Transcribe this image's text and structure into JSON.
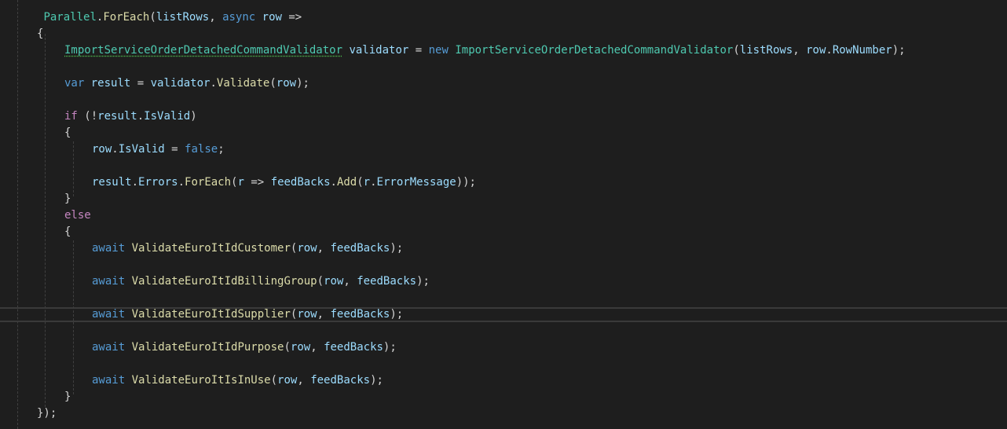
{
  "editor": {
    "theme_colors": {
      "background": "#1e1e1e",
      "plain": "#d4d4d4",
      "type": "#4ec9b0",
      "method": "#dcdcaa",
      "variable": "#9cdcfe",
      "keyword": "#569cd6",
      "control": "#c586c0"
    },
    "current_line_number": 17,
    "lines": [
      {
        "indent": 0,
        "tokens": [
          {
            "t": " ",
            "c": "plain"
          },
          {
            "t": "Parallel",
            "c": "type"
          },
          {
            "t": ".",
            "c": "plain"
          },
          {
            "t": "ForEach",
            "c": "method"
          },
          {
            "t": "(",
            "c": "plain"
          },
          {
            "t": "listRows",
            "c": "var"
          },
          {
            "t": ", ",
            "c": "plain"
          },
          {
            "t": "async",
            "c": "kw"
          },
          {
            "t": " ",
            "c": "plain"
          },
          {
            "t": "row",
            "c": "var"
          },
          {
            "t": " =>",
            "c": "plain"
          }
        ]
      },
      {
        "indent": 0,
        "tokens": [
          {
            "t": "{",
            "c": "plain"
          }
        ]
      },
      {
        "indent": 1,
        "tokens": [
          {
            "t": "ImportServiceOrderDetachedCommandValidator",
            "c": "type",
            "squiggle": true
          },
          {
            "t": " ",
            "c": "plain"
          },
          {
            "t": "validator",
            "c": "var"
          },
          {
            "t": " = ",
            "c": "plain"
          },
          {
            "t": "new",
            "c": "kw"
          },
          {
            "t": " ",
            "c": "plain"
          },
          {
            "t": "ImportServiceOrderDetachedCommandValidator",
            "c": "type"
          },
          {
            "t": "(",
            "c": "plain"
          },
          {
            "t": "listRows",
            "c": "var"
          },
          {
            "t": ", ",
            "c": "plain"
          },
          {
            "t": "row",
            "c": "var"
          },
          {
            "t": ".",
            "c": "plain"
          },
          {
            "t": "RowNumber",
            "c": "var"
          },
          {
            "t": ");",
            "c": "plain"
          }
        ]
      },
      {
        "indent": 1,
        "tokens": []
      },
      {
        "indent": 1,
        "tokens": [
          {
            "t": "var",
            "c": "kw"
          },
          {
            "t": " ",
            "c": "plain"
          },
          {
            "t": "result",
            "c": "var"
          },
          {
            "t": " = ",
            "c": "plain"
          },
          {
            "t": "validator",
            "c": "var"
          },
          {
            "t": ".",
            "c": "plain"
          },
          {
            "t": "Validate",
            "c": "method"
          },
          {
            "t": "(",
            "c": "plain"
          },
          {
            "t": "row",
            "c": "var"
          },
          {
            "t": ");",
            "c": "plain"
          }
        ]
      },
      {
        "indent": 1,
        "tokens": []
      },
      {
        "indent": 1,
        "tokens": [
          {
            "t": "if",
            "c": "ctrl"
          },
          {
            "t": " (!",
            "c": "plain"
          },
          {
            "t": "result",
            "c": "var"
          },
          {
            "t": ".",
            "c": "plain"
          },
          {
            "t": "IsValid",
            "c": "var"
          },
          {
            "t": ")",
            "c": "plain"
          }
        ]
      },
      {
        "indent": 1,
        "tokens": [
          {
            "t": "{",
            "c": "plain"
          }
        ]
      },
      {
        "indent": 2,
        "tokens": [
          {
            "t": "row",
            "c": "var"
          },
          {
            "t": ".",
            "c": "plain"
          },
          {
            "t": "IsValid",
            "c": "var"
          },
          {
            "t": " = ",
            "c": "plain"
          },
          {
            "t": "false",
            "c": "kw"
          },
          {
            "t": ";",
            "c": "plain"
          }
        ]
      },
      {
        "indent": 2,
        "tokens": []
      },
      {
        "indent": 2,
        "tokens": [
          {
            "t": "result",
            "c": "var"
          },
          {
            "t": ".",
            "c": "plain"
          },
          {
            "t": "Errors",
            "c": "var"
          },
          {
            "t": ".",
            "c": "plain"
          },
          {
            "t": "ForEach",
            "c": "method"
          },
          {
            "t": "(",
            "c": "plain"
          },
          {
            "t": "r",
            "c": "var"
          },
          {
            "t": " => ",
            "c": "plain"
          },
          {
            "t": "feedBacks",
            "c": "var"
          },
          {
            "t": ".",
            "c": "plain"
          },
          {
            "t": "Add",
            "c": "method"
          },
          {
            "t": "(",
            "c": "plain"
          },
          {
            "t": "r",
            "c": "var"
          },
          {
            "t": ".",
            "c": "plain"
          },
          {
            "t": "ErrorMessage",
            "c": "var"
          },
          {
            "t": "));",
            "c": "plain"
          }
        ]
      },
      {
        "indent": 1,
        "tokens": [
          {
            "t": "}",
            "c": "plain"
          }
        ]
      },
      {
        "indent": 1,
        "tokens": [
          {
            "t": "else",
            "c": "ctrl"
          }
        ]
      },
      {
        "indent": 1,
        "tokens": [
          {
            "t": "{",
            "c": "plain"
          }
        ]
      },
      {
        "indent": 2,
        "tokens": [
          {
            "t": "await",
            "c": "kw"
          },
          {
            "t": " ",
            "c": "plain"
          },
          {
            "t": "ValidateEuroItIdCustomer",
            "c": "method"
          },
          {
            "t": "(",
            "c": "plain"
          },
          {
            "t": "row",
            "c": "var"
          },
          {
            "t": ", ",
            "c": "plain"
          },
          {
            "t": "feedBacks",
            "c": "var"
          },
          {
            "t": ");",
            "c": "plain"
          }
        ]
      },
      {
        "indent": 2,
        "tokens": []
      },
      {
        "indent": 2,
        "tokens": [
          {
            "t": "await",
            "c": "kw"
          },
          {
            "t": " ",
            "c": "plain"
          },
          {
            "t": "ValidateEuroItIdBillingGroup",
            "c": "method"
          },
          {
            "t": "(",
            "c": "plain"
          },
          {
            "t": "row",
            "c": "var"
          },
          {
            "t": ", ",
            "c": "plain"
          },
          {
            "t": "feedBacks",
            "c": "var"
          },
          {
            "t": ");",
            "c": "plain"
          }
        ]
      },
      {
        "indent": 2,
        "tokens": []
      },
      {
        "indent": 2,
        "tokens": [
          {
            "t": "await",
            "c": "kw"
          },
          {
            "t": " ",
            "c": "plain"
          },
          {
            "t": "ValidateEuroItIdSupplier",
            "c": "method"
          },
          {
            "t": "(",
            "c": "plain"
          },
          {
            "t": "row",
            "c": "var"
          },
          {
            "t": ", ",
            "c": "plain"
          },
          {
            "t": "feedBacks",
            "c": "var"
          },
          {
            "t": ");",
            "c": "plain"
          }
        ]
      },
      {
        "indent": 2,
        "tokens": []
      },
      {
        "indent": 2,
        "tokens": [
          {
            "t": "await",
            "c": "kw"
          },
          {
            "t": " ",
            "c": "plain"
          },
          {
            "t": "ValidateEuroItIdPurpose",
            "c": "method"
          },
          {
            "t": "(",
            "c": "plain"
          },
          {
            "t": "row",
            "c": "var"
          },
          {
            "t": ", ",
            "c": "plain"
          },
          {
            "t": "feedBacks",
            "c": "var"
          },
          {
            "t": ");",
            "c": "plain"
          }
        ]
      },
      {
        "indent": 2,
        "tokens": []
      },
      {
        "indent": 2,
        "tokens": [
          {
            "t": "await",
            "c": "kw"
          },
          {
            "t": " ",
            "c": "plain"
          },
          {
            "t": "ValidateEuroItIsInUse",
            "c": "method"
          },
          {
            "t": "(",
            "c": "plain"
          },
          {
            "t": "row",
            "c": "var"
          },
          {
            "t": ", ",
            "c": "plain"
          },
          {
            "t": "feedBacks",
            "c": "var"
          },
          {
            "t": ");",
            "c": "plain"
          }
        ]
      },
      {
        "indent": 1,
        "tokens": [
          {
            "t": "}",
            "c": "plain"
          }
        ]
      },
      {
        "indent": 0,
        "tokens": [
          {
            "t": "});",
            "c": "plain"
          }
        ]
      }
    ]
  }
}
